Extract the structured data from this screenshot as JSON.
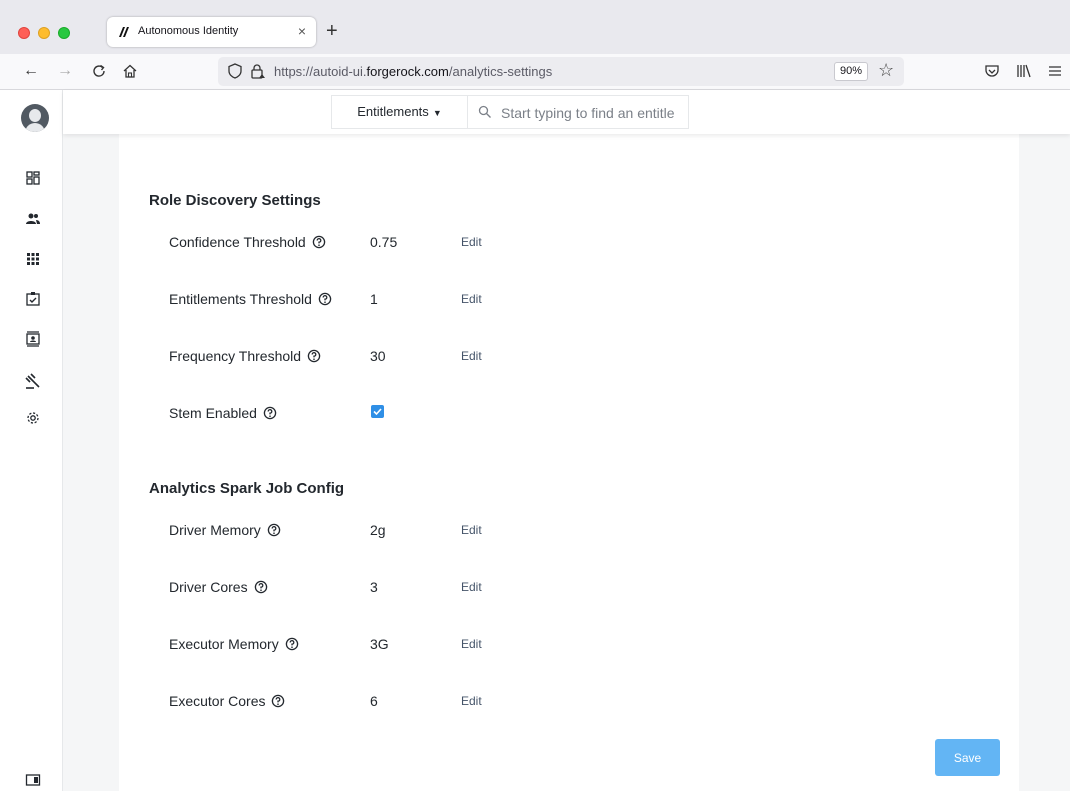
{
  "browser": {
    "tab_title": "Autonomous Identity",
    "tab_close": "×",
    "new_tab": "+",
    "url_prefix": "https://autoid-ui.",
    "url_domain": "forgerock.com",
    "url_path": "/analytics-settings",
    "zoom": "90%"
  },
  "topbar": {
    "entity_select": "Entitlements",
    "search_placeholder": "Start typing to find an entitle"
  },
  "sections": [
    {
      "title": "Role Discovery Settings",
      "rows": [
        {
          "label": "Confidence Threshold",
          "value": "0.75",
          "action": "Edit"
        },
        {
          "label": "Entitlements Threshold",
          "value": "1",
          "action": "Edit"
        },
        {
          "label": "Frequency Threshold",
          "value": "30",
          "action": "Edit"
        },
        {
          "label": "Stem Enabled",
          "checked": true
        }
      ]
    },
    {
      "title": "Analytics Spark Job Config",
      "rows": [
        {
          "label": "Driver Memory",
          "value": "2g",
          "action": "Edit"
        },
        {
          "label": "Driver Cores",
          "value": "3",
          "action": "Edit"
        },
        {
          "label": "Executor Memory",
          "value": "3G",
          "action": "Edit"
        },
        {
          "label": "Executor Cores",
          "value": "6",
          "action": "Edit"
        }
      ]
    }
  ],
  "save_label": "Save",
  "colors": {
    "accent": "#2f8fe6",
    "save_button": "#63b5f4",
    "canvas": "#f5f6f7"
  }
}
